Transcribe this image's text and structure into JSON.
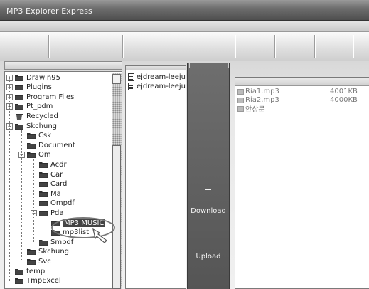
{
  "window": {
    "title": "MP3 Explorer Express"
  },
  "tree": {
    "nodes": [
      {
        "label": "Drawin95",
        "level": 0,
        "expander": "+"
      },
      {
        "label": "Plugins",
        "level": 0,
        "expander": "+"
      },
      {
        "label": "Program Files",
        "level": 0,
        "expander": "+"
      },
      {
        "label": "Pt_pdm",
        "level": 0,
        "expander": "+"
      },
      {
        "label": "Recycled",
        "level": 0,
        "expander": ""
      },
      {
        "label": "Skchung",
        "level": 0,
        "expander": "−"
      },
      {
        "label": "Csk",
        "level": 1,
        "expander": ""
      },
      {
        "label": "Document",
        "level": 1,
        "expander": ""
      },
      {
        "label": "Om",
        "level": 1,
        "expander": "−"
      },
      {
        "label": "Acdr",
        "level": 2,
        "expander": ""
      },
      {
        "label": "Car",
        "level": 2,
        "expander": ""
      },
      {
        "label": "Card",
        "level": 2,
        "expander": ""
      },
      {
        "label": "Ma",
        "level": 2,
        "expander": ""
      },
      {
        "label": "Ompdf",
        "level": 2,
        "expander": ""
      },
      {
        "label": "Pda",
        "level": 2,
        "expander": "−"
      },
      {
        "label": "MP3 MUSIC",
        "level": 3,
        "expander": ""
      },
      {
        "label": "mp3list",
        "level": 3,
        "expander": ""
      },
      {
        "label": "Smpdf",
        "level": 2,
        "expander": ""
      },
      {
        "label": "Skchung",
        "level": 1,
        "expander": ""
      },
      {
        "label": "Svc",
        "level": 1,
        "expander": ""
      },
      {
        "label": "temp",
        "level": 0,
        "expander": ""
      },
      {
        "label": "TmpExcel",
        "level": 0,
        "expander": ""
      }
    ]
  },
  "files": {
    "items": [
      {
        "label": "ejdream-leeju"
      },
      {
        "label": "ejdream-leeju"
      }
    ]
  },
  "transfer": {
    "download_label": "Download",
    "upload_label": "Upload"
  },
  "player": {
    "rows": [
      {
        "name": "Ria1.mp3",
        "size": "4001KB"
      },
      {
        "name": "Ria2.mp3",
        "size": "4000KB"
      },
      {
        "name": "안상문",
        "size": ""
      }
    ]
  },
  "colors": {
    "titlebar": "#5a5a5a",
    "transfer_panel": "#5f5f5f",
    "selection": "#444444"
  }
}
